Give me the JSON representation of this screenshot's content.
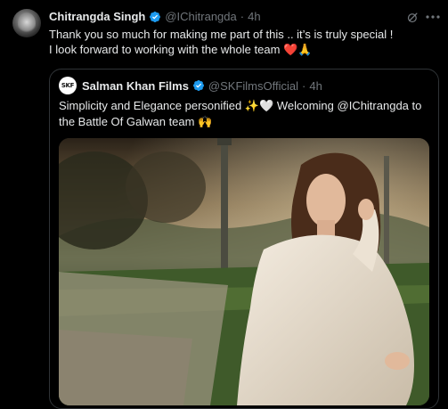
{
  "author": {
    "name": "Chitrangda Singh",
    "handle": "@IChitrangda",
    "separator": "·",
    "time": "4h"
  },
  "post": {
    "line1": "Thank you so much for making me part of this .. it’s is truly special !",
    "line2": "I look forward to working with the whole team ❤️🙏"
  },
  "quoted": {
    "avatar_text": "SKF",
    "name": "Salman Khan Films",
    "handle": "@SKFilmsOfficial",
    "separator": "·",
    "time": "4h",
    "line1": "Simplicity and Elegance personified ✨🤍 Welcoming @IChitrangda to",
    "line2": "the Battle Of Galwan team 🙌"
  },
  "icons": {
    "verified": "verified-badge-icon",
    "grok": "grok-icon",
    "more": "more-icon"
  },
  "colors": {
    "background": "#000000",
    "text": "#e7e9ea",
    "muted": "#71767b",
    "verified": "#1d9bf0",
    "border": "#2f3336"
  }
}
